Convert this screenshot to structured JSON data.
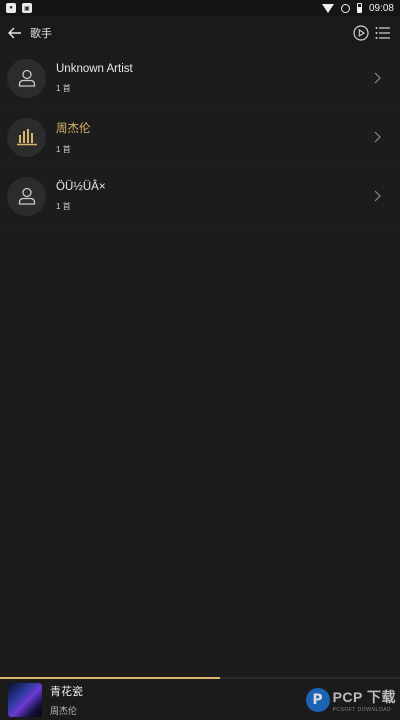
{
  "status_bar": {
    "time": "09:08",
    "left_icons": [
      "notification-icon",
      "notification-icon"
    ],
    "right_icons": [
      "wifi-icon",
      "data-saver-icon",
      "battery-icon"
    ]
  },
  "header": {
    "title": "歌手",
    "back_icon": "arrow-left-icon",
    "actions": [
      "play-circle-icon",
      "menu-list-icon"
    ]
  },
  "artists": [
    {
      "name": "Unknown Artist",
      "count": "1 首",
      "icon": "person-icon",
      "active": false
    },
    {
      "name": "周杰伦",
      "count": "1 首",
      "icon": "equalizer-icon",
      "active": true
    },
    {
      "name": "ÖÜ½ÜÂ×",
      "count": "1 首",
      "icon": "person-icon",
      "active": false
    }
  ],
  "player": {
    "song": "青花瓷",
    "artist": "周杰伦",
    "progress": 0.55
  },
  "watermark": {
    "logo": "P",
    "text": "PCP 下载",
    "sub": "PCSOFT DOWNLOAD"
  },
  "colors": {
    "accent": "#d9b56a",
    "background": "#1c1c1c"
  }
}
